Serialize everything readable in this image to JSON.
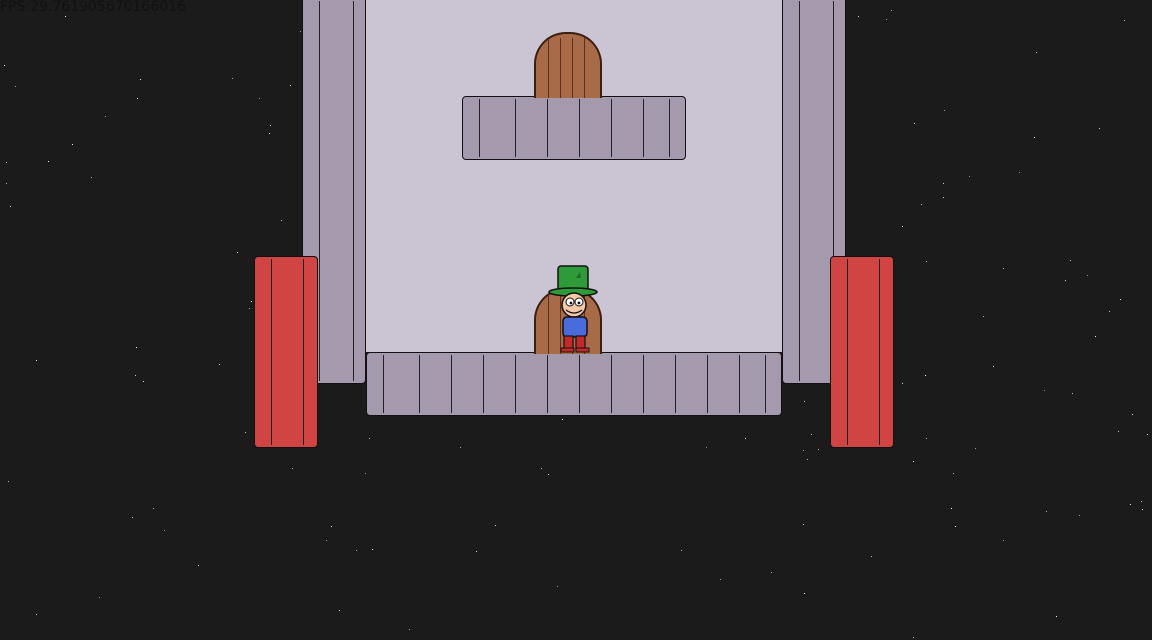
{
  "hud": {
    "fps_text": "FPS:29.761905670166016"
  },
  "colors": {
    "space_background": "#1b1b1b",
    "room_background": "#cbc4d2",
    "stone": "#a59aad",
    "red_block": "#d14444",
    "door_wood": "#a86a47",
    "hat_green": "#2f9a39",
    "shirt_blue": "#4a6bdc",
    "pants_red": "#c22a2a"
  },
  "scene": {
    "doors": [
      {
        "name": "upper-door"
      },
      {
        "name": "lower-door"
      }
    ],
    "player": {
      "name": "player-character",
      "icon": "leprechaun-top-hat"
    }
  }
}
